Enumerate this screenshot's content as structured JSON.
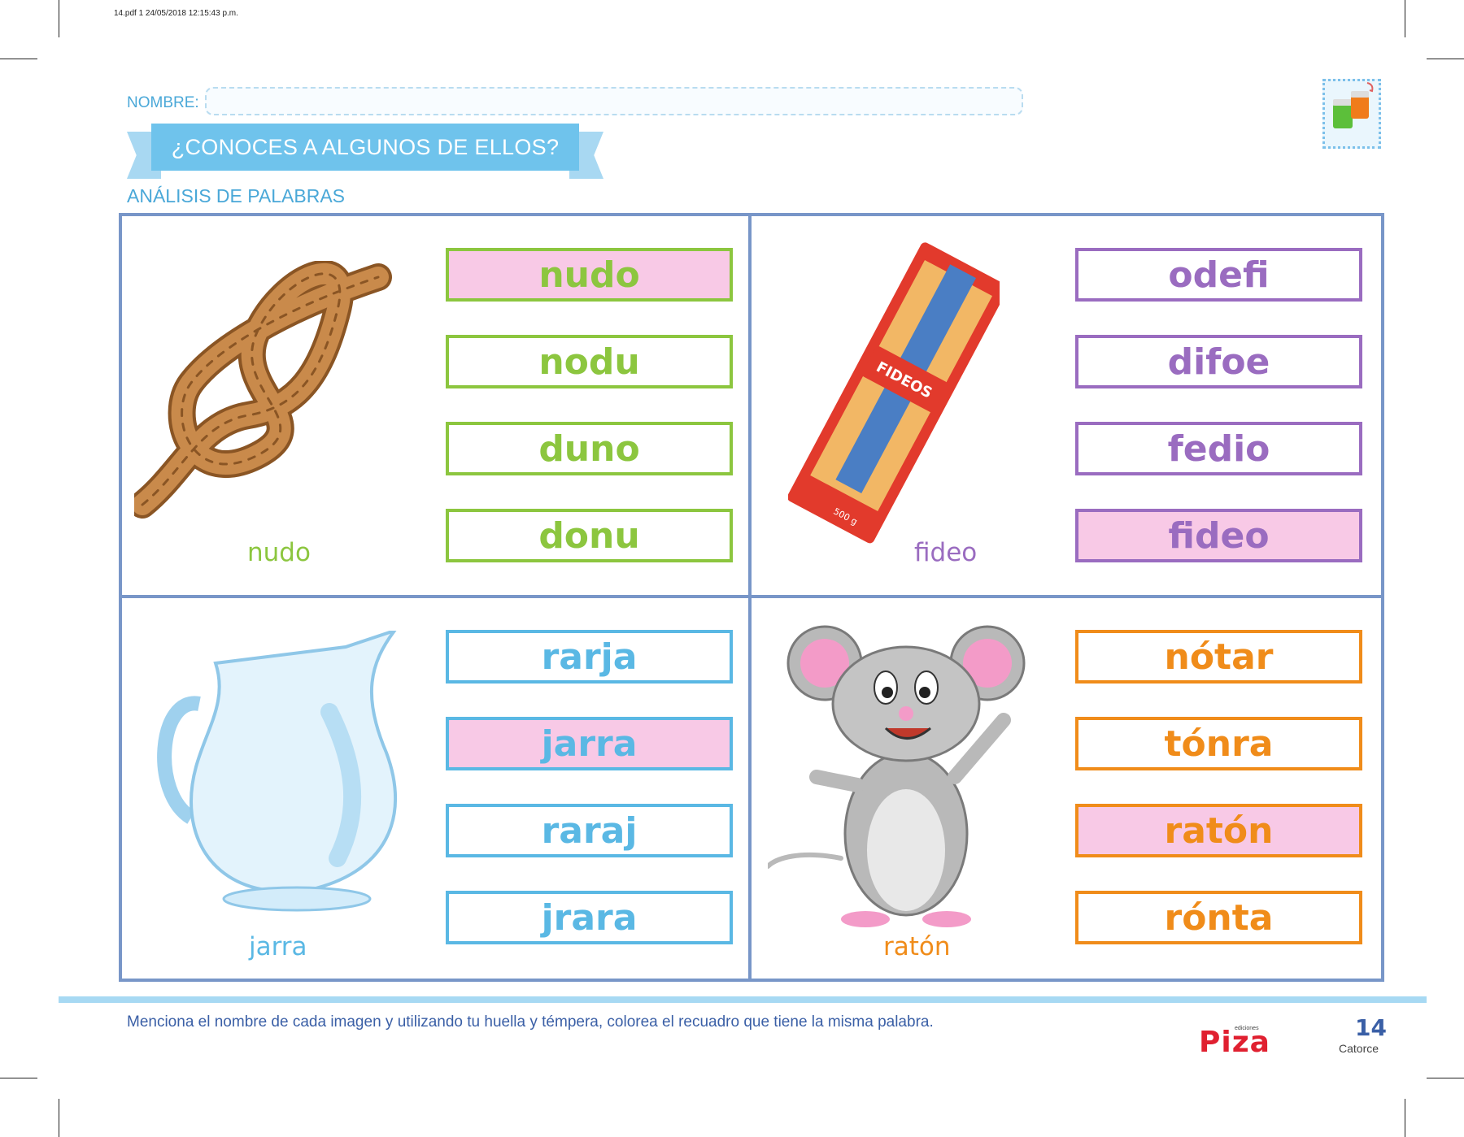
{
  "file_meta": "14.pdf   1   24/05/2018   12:15:43 p.m.",
  "header": {
    "nombre_label": "NOMBRE:",
    "banner_title": "¿CONOCES A ALGUNOS DE ELLOS?",
    "subtitle": "ANÁLISIS DE PALABRAS"
  },
  "quadrants": [
    {
      "caption": "nudo",
      "color": "#8cc63f",
      "icon": "rope-knot",
      "options": [
        {
          "text": "nudo",
          "highlighted": true
        },
        {
          "text": "nodu",
          "highlighted": false
        },
        {
          "text": "duno",
          "highlighted": false
        },
        {
          "text": "donu",
          "highlighted": false
        }
      ]
    },
    {
      "caption": "fideo",
      "color": "#9a6cc0",
      "icon": "pasta-package",
      "package_label": "FIDEOS",
      "package_weight": "500 g",
      "options": [
        {
          "text": "odefi",
          "highlighted": false
        },
        {
          "text": "difoe",
          "highlighted": false
        },
        {
          "text": "fedio",
          "highlighted": false
        },
        {
          "text": "fideo",
          "highlighted": true
        }
      ]
    },
    {
      "caption": "jarra",
      "color": "#5ab8e4",
      "icon": "glass-pitcher",
      "options": [
        {
          "text": "rarja",
          "highlighted": false
        },
        {
          "text": "jarra",
          "highlighted": true
        },
        {
          "text": "raraj",
          "highlighted": false
        },
        {
          "text": "jrara",
          "highlighted": false
        }
      ]
    },
    {
      "caption": "ratón",
      "color": "#f08c1a",
      "icon": "cartoon-mouse",
      "options": [
        {
          "text": "nótar",
          "highlighted": false
        },
        {
          "text": "tónra",
          "highlighted": false
        },
        {
          "text": "ratón",
          "highlighted": true
        },
        {
          "text": "rónta",
          "highlighted": false
        }
      ]
    }
  ],
  "footer": {
    "instruction": "Menciona el nombre de cada imagen y utilizando tu huella y témpera, colorea el recuadro que tiene la misma palabra.",
    "publisher_small": "ediciones",
    "publisher": "Piza",
    "page_number": "14",
    "page_word": "Catorce"
  },
  "colors": {
    "frame": "#7896c8",
    "highlight": "#f8c9e6",
    "banner": "#6fc3ec",
    "accent_text": "#4aa8d8"
  }
}
